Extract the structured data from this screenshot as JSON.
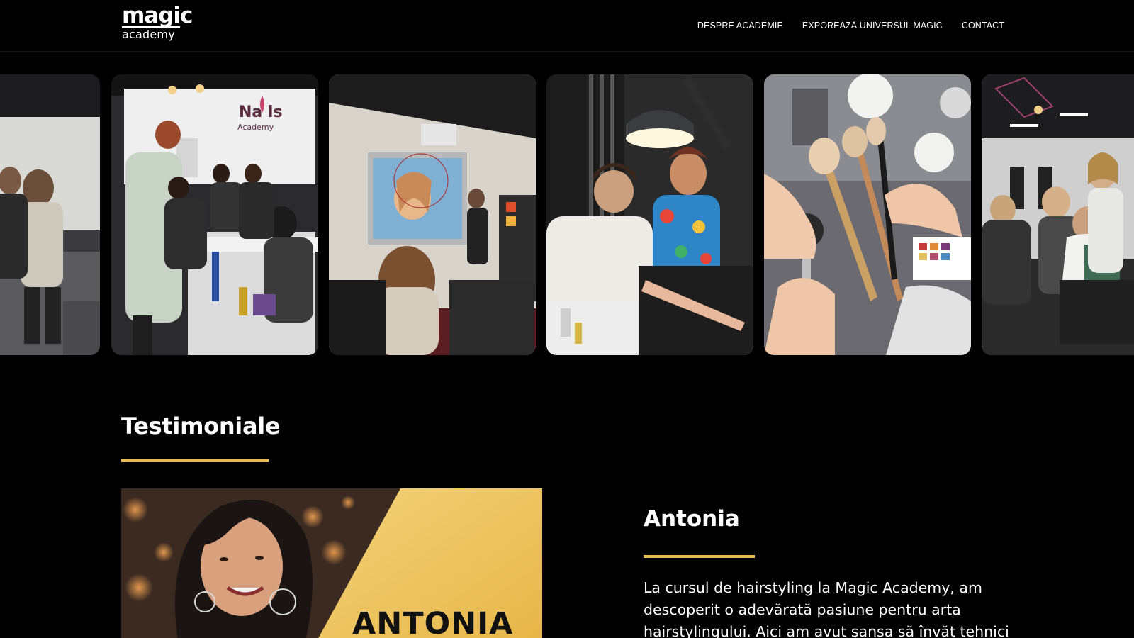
{
  "header": {
    "logo_top": "magic",
    "logo_bottom": "academy",
    "nav": [
      {
        "label": "DESPRE ACADEMIE"
      },
      {
        "label": "EXPOREAZĂ UNIVERSUL MAGIC"
      },
      {
        "label": "CONTACT"
      }
    ]
  },
  "gallery": {
    "photos": [
      {
        "alt": "academy-classroom-group"
      },
      {
        "alt": "nails-academy-training"
      },
      {
        "alt": "hairstyling-presentation"
      },
      {
        "alt": "manicure-practice"
      },
      {
        "alt": "makeup-brushes"
      },
      {
        "alt": "salon-students"
      }
    ],
    "sign_text": "Nails Academy"
  },
  "testimonials": {
    "title": "Testimoniale",
    "item": {
      "image_label": "ANTONIA",
      "name": "Antonia",
      "text": "La cursul de hairstyling la Magic Academy, am descoperit o adevărată pasiune pentru arta hairstylingului. Aici am avut șansa să învăț tehnici"
    }
  },
  "colors": {
    "accent": "#e8b94e",
    "background": "#000000"
  }
}
